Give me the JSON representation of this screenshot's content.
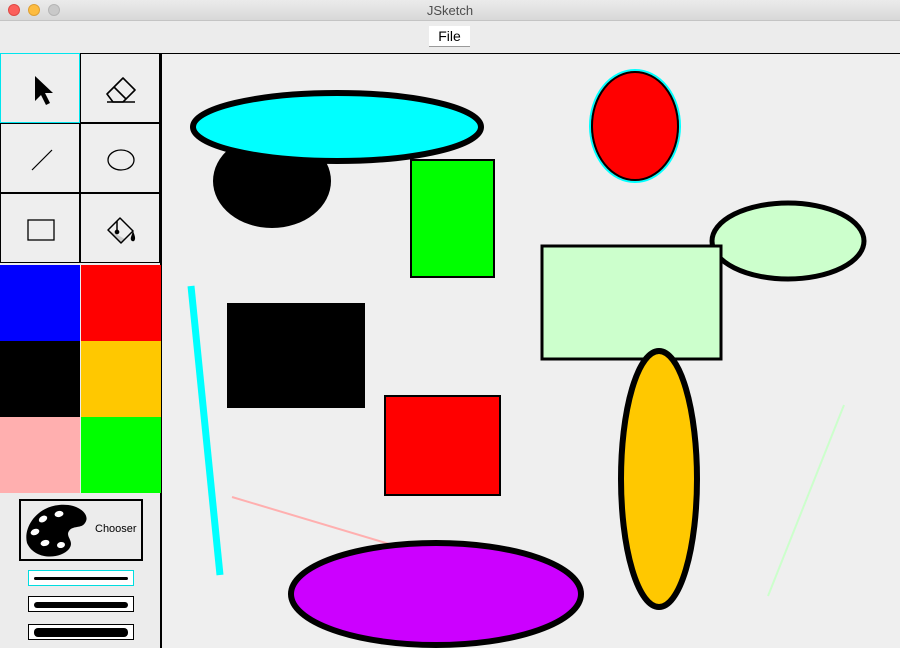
{
  "window": {
    "title": "JSketch"
  },
  "menu": {
    "file_label": "File"
  },
  "tools": {
    "items": [
      {
        "name": "select-tool",
        "icon": "arrow-pointer-icon",
        "selected": true
      },
      {
        "name": "eraser-tool",
        "icon": "eraser-icon",
        "selected": false
      },
      {
        "name": "line-tool",
        "icon": "line-icon",
        "selected": false
      },
      {
        "name": "ellipse-tool",
        "icon": "ellipse-icon",
        "selected": false
      },
      {
        "name": "rectangle-tool",
        "icon": "rectangle-icon",
        "selected": false
      },
      {
        "name": "fill-tool",
        "icon": "paint-bucket-icon",
        "selected": false
      }
    ]
  },
  "palette": {
    "colors": [
      "#0000ff",
      "#ff0000",
      "#000000",
      "#ffc800",
      "#ffafaf",
      "#00ff00"
    ]
  },
  "chooser": {
    "label": "Chooser",
    "icon": "palette-icon"
  },
  "line_thickness": {
    "options": [
      "thin",
      "medium",
      "thick"
    ],
    "selected": "thin"
  },
  "colors": {
    "selection_highlight": "#00ffff"
  }
}
